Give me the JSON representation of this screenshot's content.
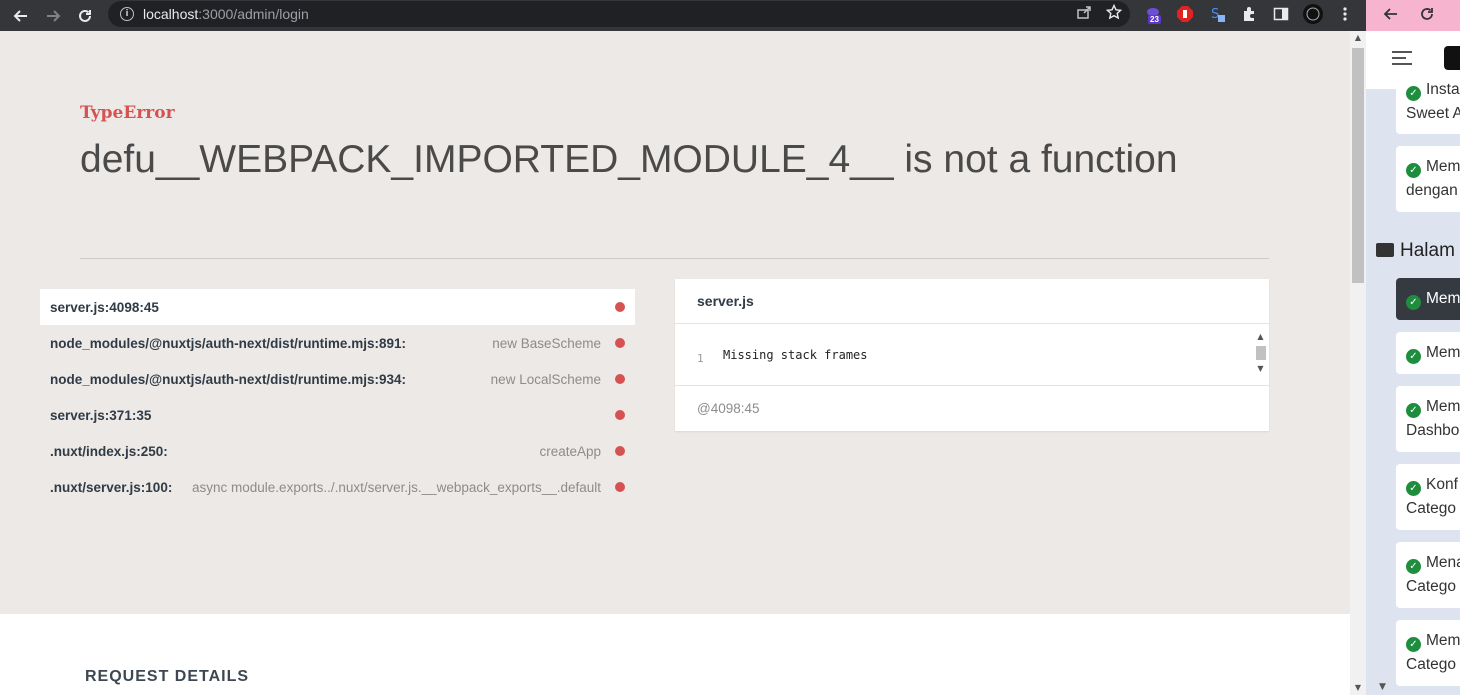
{
  "browser": {
    "url_host": "localhost",
    "url_rest": ":3000/admin/login",
    "extension_badge": "23"
  },
  "error": {
    "type": "TypeError",
    "message": "defu__WEBPACK_IMPORTED_MODULE_4__ is not a function"
  },
  "frames": [
    {
      "file": "server.js:4098:45",
      "fn": ""
    },
    {
      "file": "node_modules/@nuxtjs/auth-next/dist/runtime.mjs:891:",
      "fn": "new BaseScheme"
    },
    {
      "file": "node_modules/@nuxtjs/auth-next/dist/runtime.mjs:934:",
      "fn": "new LocalScheme"
    },
    {
      "file": "server.js:371:35",
      "fn": ""
    },
    {
      "file": ".nuxt/index.js:250:",
      "fn": "createApp"
    },
    {
      "file": ".nuxt/server.js:100:",
      "fn": "async module.exports../.nuxt/server.js.__webpack_exports__.default"
    }
  ],
  "code_panel": {
    "filename": "server.js",
    "line_number": "1",
    "code": "Missing stack frames",
    "location": "@4098:45"
  },
  "request": {
    "heading": "REQUEST DETAILS"
  },
  "sidebar": {
    "cards": [
      {
        "line1": "Insta",
        "line2": "Sweet A"
      },
      {
        "line1": "Mem",
        "line2": "dengan"
      },
      {
        "line1": "Mem",
        "line2": ""
      },
      {
        "line1": "Mem",
        "line2": ""
      },
      {
        "line1": "Mem",
        "line2": "Dashbo"
      },
      {
        "line1": "Konf",
        "line2": "Catego"
      },
      {
        "line1": "Mena",
        "line2": "Catego"
      },
      {
        "line1": "Mem",
        "line2": "Catego"
      }
    ],
    "section_title": "Halam"
  },
  "colors": {
    "error_red": "#d65252",
    "page_bg": "#ece9e6",
    "check_green": "#1e8e3e"
  }
}
